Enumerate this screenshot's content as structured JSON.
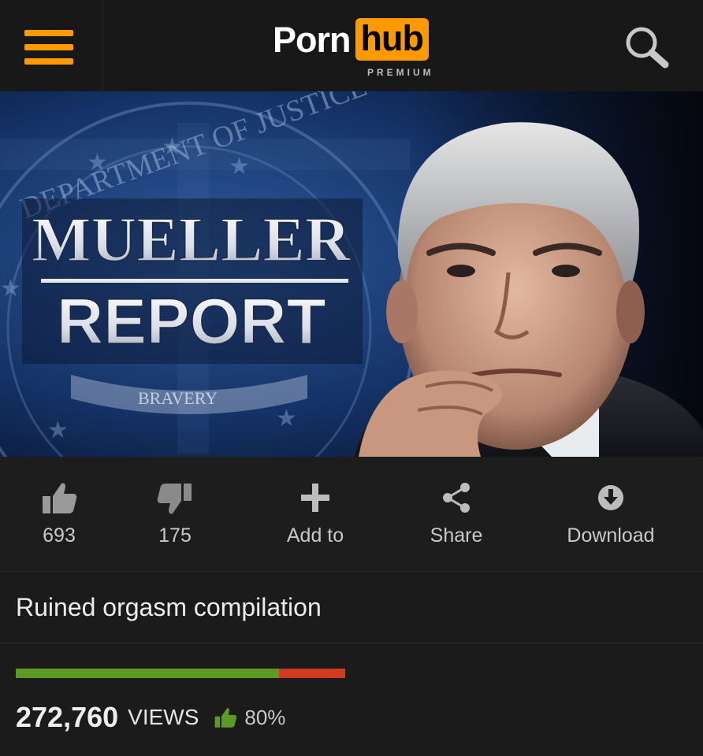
{
  "header": {
    "logo_left": "Porn",
    "logo_right": "hub",
    "tier": "PREMIUM",
    "brand_color": "#ff9900"
  },
  "hero": {
    "headline_line1": "MUELLER",
    "headline_line2": "REPORT",
    "seal_text_top": "DEPARTMENT OF JUSTICE",
    "seal_banner": "BRAVERY"
  },
  "actions": {
    "like_count": "693",
    "dislike_count": "175",
    "add_label": "Add to",
    "share_label": "Share",
    "download_label": "Download"
  },
  "video": {
    "title": "Ruined orgasm compilation",
    "views": "272,760",
    "views_label": "VIEWS",
    "rating_percent": "80%",
    "rating_fraction": 0.8
  },
  "colors": {
    "rating_good": "#5c9a23",
    "rating_bad": "#d03a1e"
  }
}
